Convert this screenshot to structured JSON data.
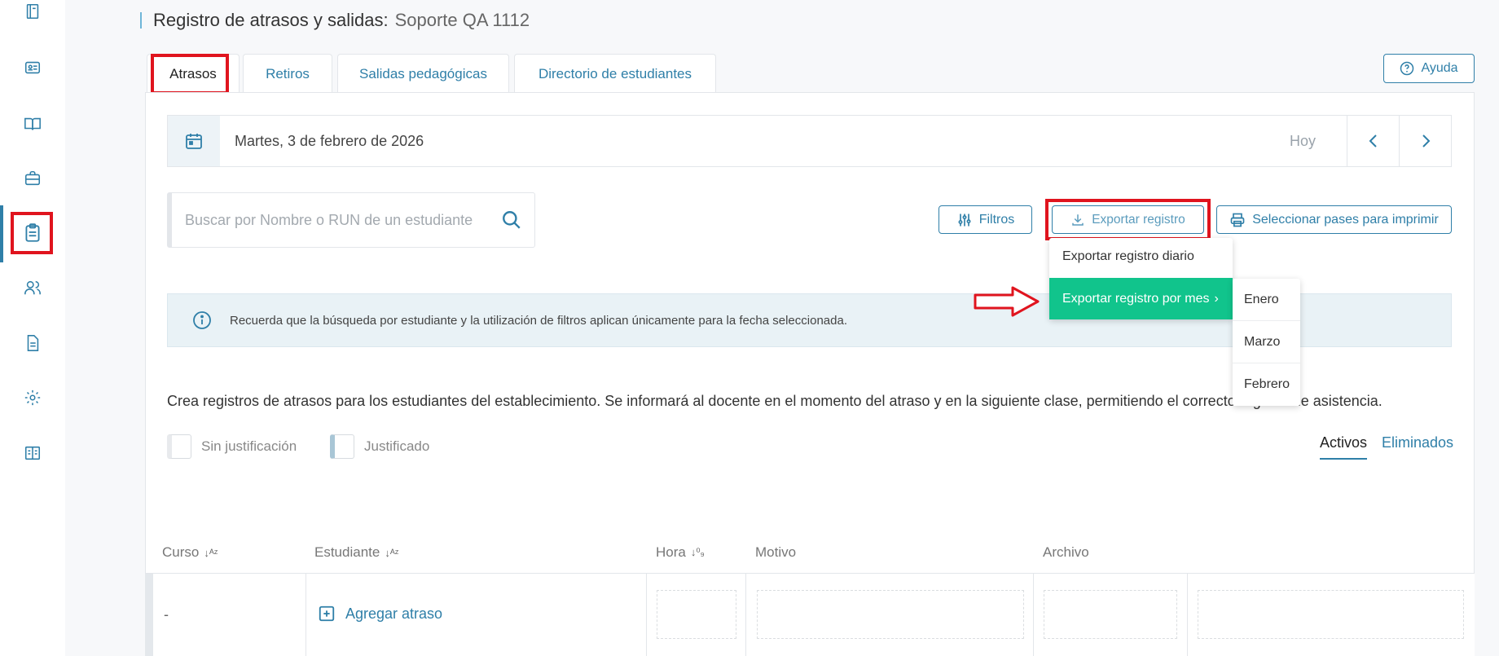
{
  "header": {
    "title": "Registro de atrasos y salidas:",
    "subtitle": "Soporte QA 1112"
  },
  "tabs": [
    {
      "label": "Atrasos"
    },
    {
      "label": "Retiros"
    },
    {
      "label": "Salidas pedagógicas"
    },
    {
      "label": "Directorio de estudiantes"
    }
  ],
  "help": {
    "label": "Ayuda"
  },
  "datebar": {
    "date": "Martes, 3 de febrero de 2026",
    "today": "Hoy"
  },
  "search": {
    "placeholder": "Buscar por Nombre o RUN de un estudiante"
  },
  "toolbar": {
    "filters": "Filtros",
    "export": "Exportar registro",
    "print": "Seleccionar pases para imprimir"
  },
  "export_menu": {
    "daily": "Exportar registro diario",
    "monthly": "Exportar registro por mes",
    "months": [
      "Enero",
      "Marzo",
      "Febrero"
    ]
  },
  "info": {
    "text": "Recuerda que la búsqueda por estudiante y la utilización de filtros aplican únicamente para la fecha seleccionada."
  },
  "description": "Crea registros de atrasos para los estudiantes del establecimiento. Se informará al docente en el momento del atraso y en la siguiente clase, permitiendo el correcto registro de asistencia.",
  "legend": {
    "unjustified": "Sin justificación",
    "justified": "Justificado"
  },
  "status_tabs": {
    "active": "Activos",
    "deleted": "Eliminados"
  },
  "table": {
    "headers": {
      "course": "Curso",
      "student": "Estudiante",
      "time": "Hora",
      "reason": "Motivo",
      "file": "Archivo"
    },
    "row": {
      "course": "-",
      "add": "Agregar atraso"
    }
  },
  "colors": {
    "accent": "#2f7fa8",
    "menu_highlight": "#11c48c",
    "annotation_red": "#e0141e"
  }
}
